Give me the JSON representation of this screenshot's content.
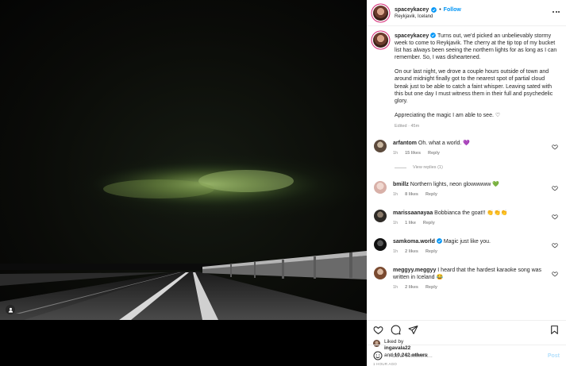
{
  "post": {
    "author": "spaceykacey",
    "separator": "•",
    "follow_label": "Follow",
    "location": "Reykjavik, Iceland"
  },
  "caption": {
    "username": "spaceykacey",
    "paragraphs": [
      "Turns out, we'd picked an unbelievably stormy week to come to Reykjavik. The cherry at the tip top of my bucket list has always been seeing the northern lights for as long as I can remember. So, I was disheartened.",
      "On our last night, we drove a couple hours outside of town and around midnight finally got to the nearest spot of partial cloud break just to be able to catch a faint whisper. Leaving sated with this but one day I must witness them in their full and psychedelic glory.",
      "Appreciating the magic I am able to see. ♡"
    ],
    "meta": "Edited · 45m"
  },
  "comments": [
    {
      "username": "arfantom",
      "text": "Oh. what a world. 💜",
      "age": "1h",
      "likes": "15 likes",
      "reply": "Reply",
      "view_replies": "View replies (1)"
    },
    {
      "username": "bmillz",
      "text": "Northern lights, neon glowwwww 💚",
      "age": "1h",
      "likes": "8 likes",
      "reply": "Reply"
    },
    {
      "username": "marissaanayaa",
      "text": "Bobbianca the goat!! 👏👏👏",
      "age": "1h",
      "likes": "1 like",
      "reply": "Reply"
    },
    {
      "username": "samkoma.world",
      "text": "Magic just like you.",
      "age": "1h",
      "likes": "2 likes",
      "reply": "Reply"
    },
    {
      "username": "meggyy.meggyy",
      "text": "I heard that the hardest karaoke song was written in Iceland 😂",
      "age": "1h",
      "likes": "2 likes",
      "reply": "Reply"
    }
  ],
  "likes_section": {
    "liked_by_prefix": "Liked by",
    "liked_by_user": "ingavala22",
    "and_text": "and",
    "others_count": "10,242 others",
    "time_ago": "1 HOUR AGO"
  },
  "add_comment": {
    "placeholder": "Add a comment...",
    "post_label": "Post"
  },
  "icons": {
    "more": "more-horizontal-icon",
    "like": "heart-icon",
    "comment": "comment-bubble-icon",
    "share": "paper-plane-icon",
    "save": "bookmark-icon",
    "emoji": "smiley-icon",
    "user_tag": "user-tag-icon",
    "verified": "verified-badge-icon"
  },
  "colors": {
    "accent": "#0095f6",
    "aurora": "#7a9a4a",
    "verified": "#0095f6"
  }
}
